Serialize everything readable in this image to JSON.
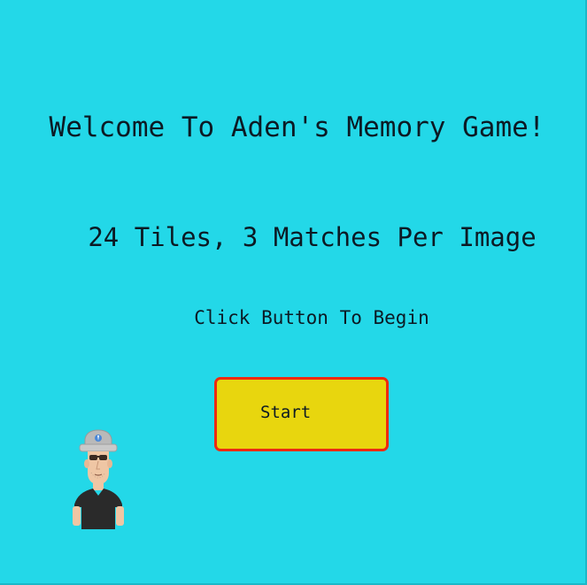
{
  "screen": {
    "title": "Welcome To Aden's Memory Game!",
    "subtitle": "24 Tiles, 3 Matches Per Image",
    "prompt": "Click Button To Begin",
    "start_label": "Start"
  },
  "avatar": {
    "icon": "character-avatar-icon"
  },
  "colors": {
    "background": "#23d8e8",
    "button_fill": "#e8d60e",
    "button_border": "#ee2a10",
    "text": "#0c1a24"
  }
}
